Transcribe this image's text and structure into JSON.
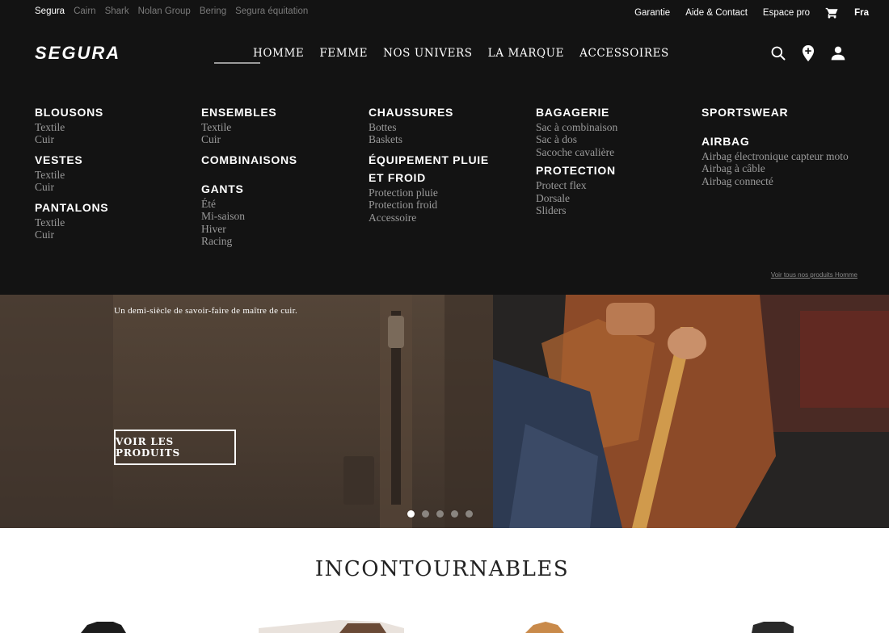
{
  "topbar": {
    "brands": [
      "Segura",
      "Cairn",
      "Shark",
      "Nolan Group",
      "Bering",
      "Segura équitation"
    ],
    "active_brand": "Segura",
    "links": [
      "Garantie",
      "Aide & Contact",
      "Espace pro"
    ],
    "language": "Fra"
  },
  "header": {
    "logo_text": "SEGURA",
    "nav": [
      "HOMME",
      "FEMME",
      "NOS UNIVERS",
      "LA MARQUE",
      "ACCESSOIRES"
    ],
    "icons": [
      "search-icon",
      "store-locator-icon",
      "account-icon"
    ]
  },
  "menu": {
    "col1": [
      {
        "title": "BLOUSONS",
        "items": [
          "Textile",
          "Cuir"
        ]
      },
      {
        "title": "VESTES",
        "items": [
          "Textile",
          "Cuir"
        ]
      },
      {
        "title": "PANTALONS",
        "items": [
          "Textile",
          "Cuir"
        ]
      }
    ],
    "col2": [
      {
        "title": "ENSEMBLES",
        "items": [
          "Textile",
          "Cuir"
        ]
      },
      {
        "title": "COMBINAISONS",
        "items": []
      },
      {
        "title": "GANTS",
        "items": [
          "Été",
          "Mi-saison",
          "Hiver",
          "Racing"
        ]
      }
    ],
    "col3": [
      {
        "title": "CHAUSSURES",
        "items": [
          "Bottes",
          "Baskets"
        ]
      },
      {
        "title": "ÉQUIPEMENT PLUIE",
        "title2": "ET FROID",
        "items": [
          "Protection pluie",
          "Protection froid",
          "Accessoire"
        ]
      }
    ],
    "col4": [
      {
        "title": "BAGAGERIE",
        "items": [
          "Sac à combinaison",
          "Sac à dos",
          "Sacoche cavalière"
        ]
      },
      {
        "title": "PROTECTION",
        "items": [
          "Protect flex",
          "Dorsale",
          "Sliders"
        ]
      }
    ],
    "col5": [
      {
        "title": "SPORTSWEAR",
        "items": []
      },
      {
        "title": "AIRBAG",
        "items": [
          "Airbag électronique capteur moto",
          "Airbag à câble",
          "Airbag connecté"
        ]
      }
    ],
    "see_all": "Voir tous nos produits Homme"
  },
  "hero": {
    "tagline": "Un demi-siècle de savoir-faire de maître de cuir.",
    "cta": "VOIR LES PRODUITS",
    "slides": 5,
    "active_slide": 1
  },
  "section": {
    "title": "INCONTOURNABLES"
  },
  "colors": {
    "header_bg": "#131313",
    "menu_subtext": "#9a9a9a",
    "hero_left": "#4a3c31"
  }
}
